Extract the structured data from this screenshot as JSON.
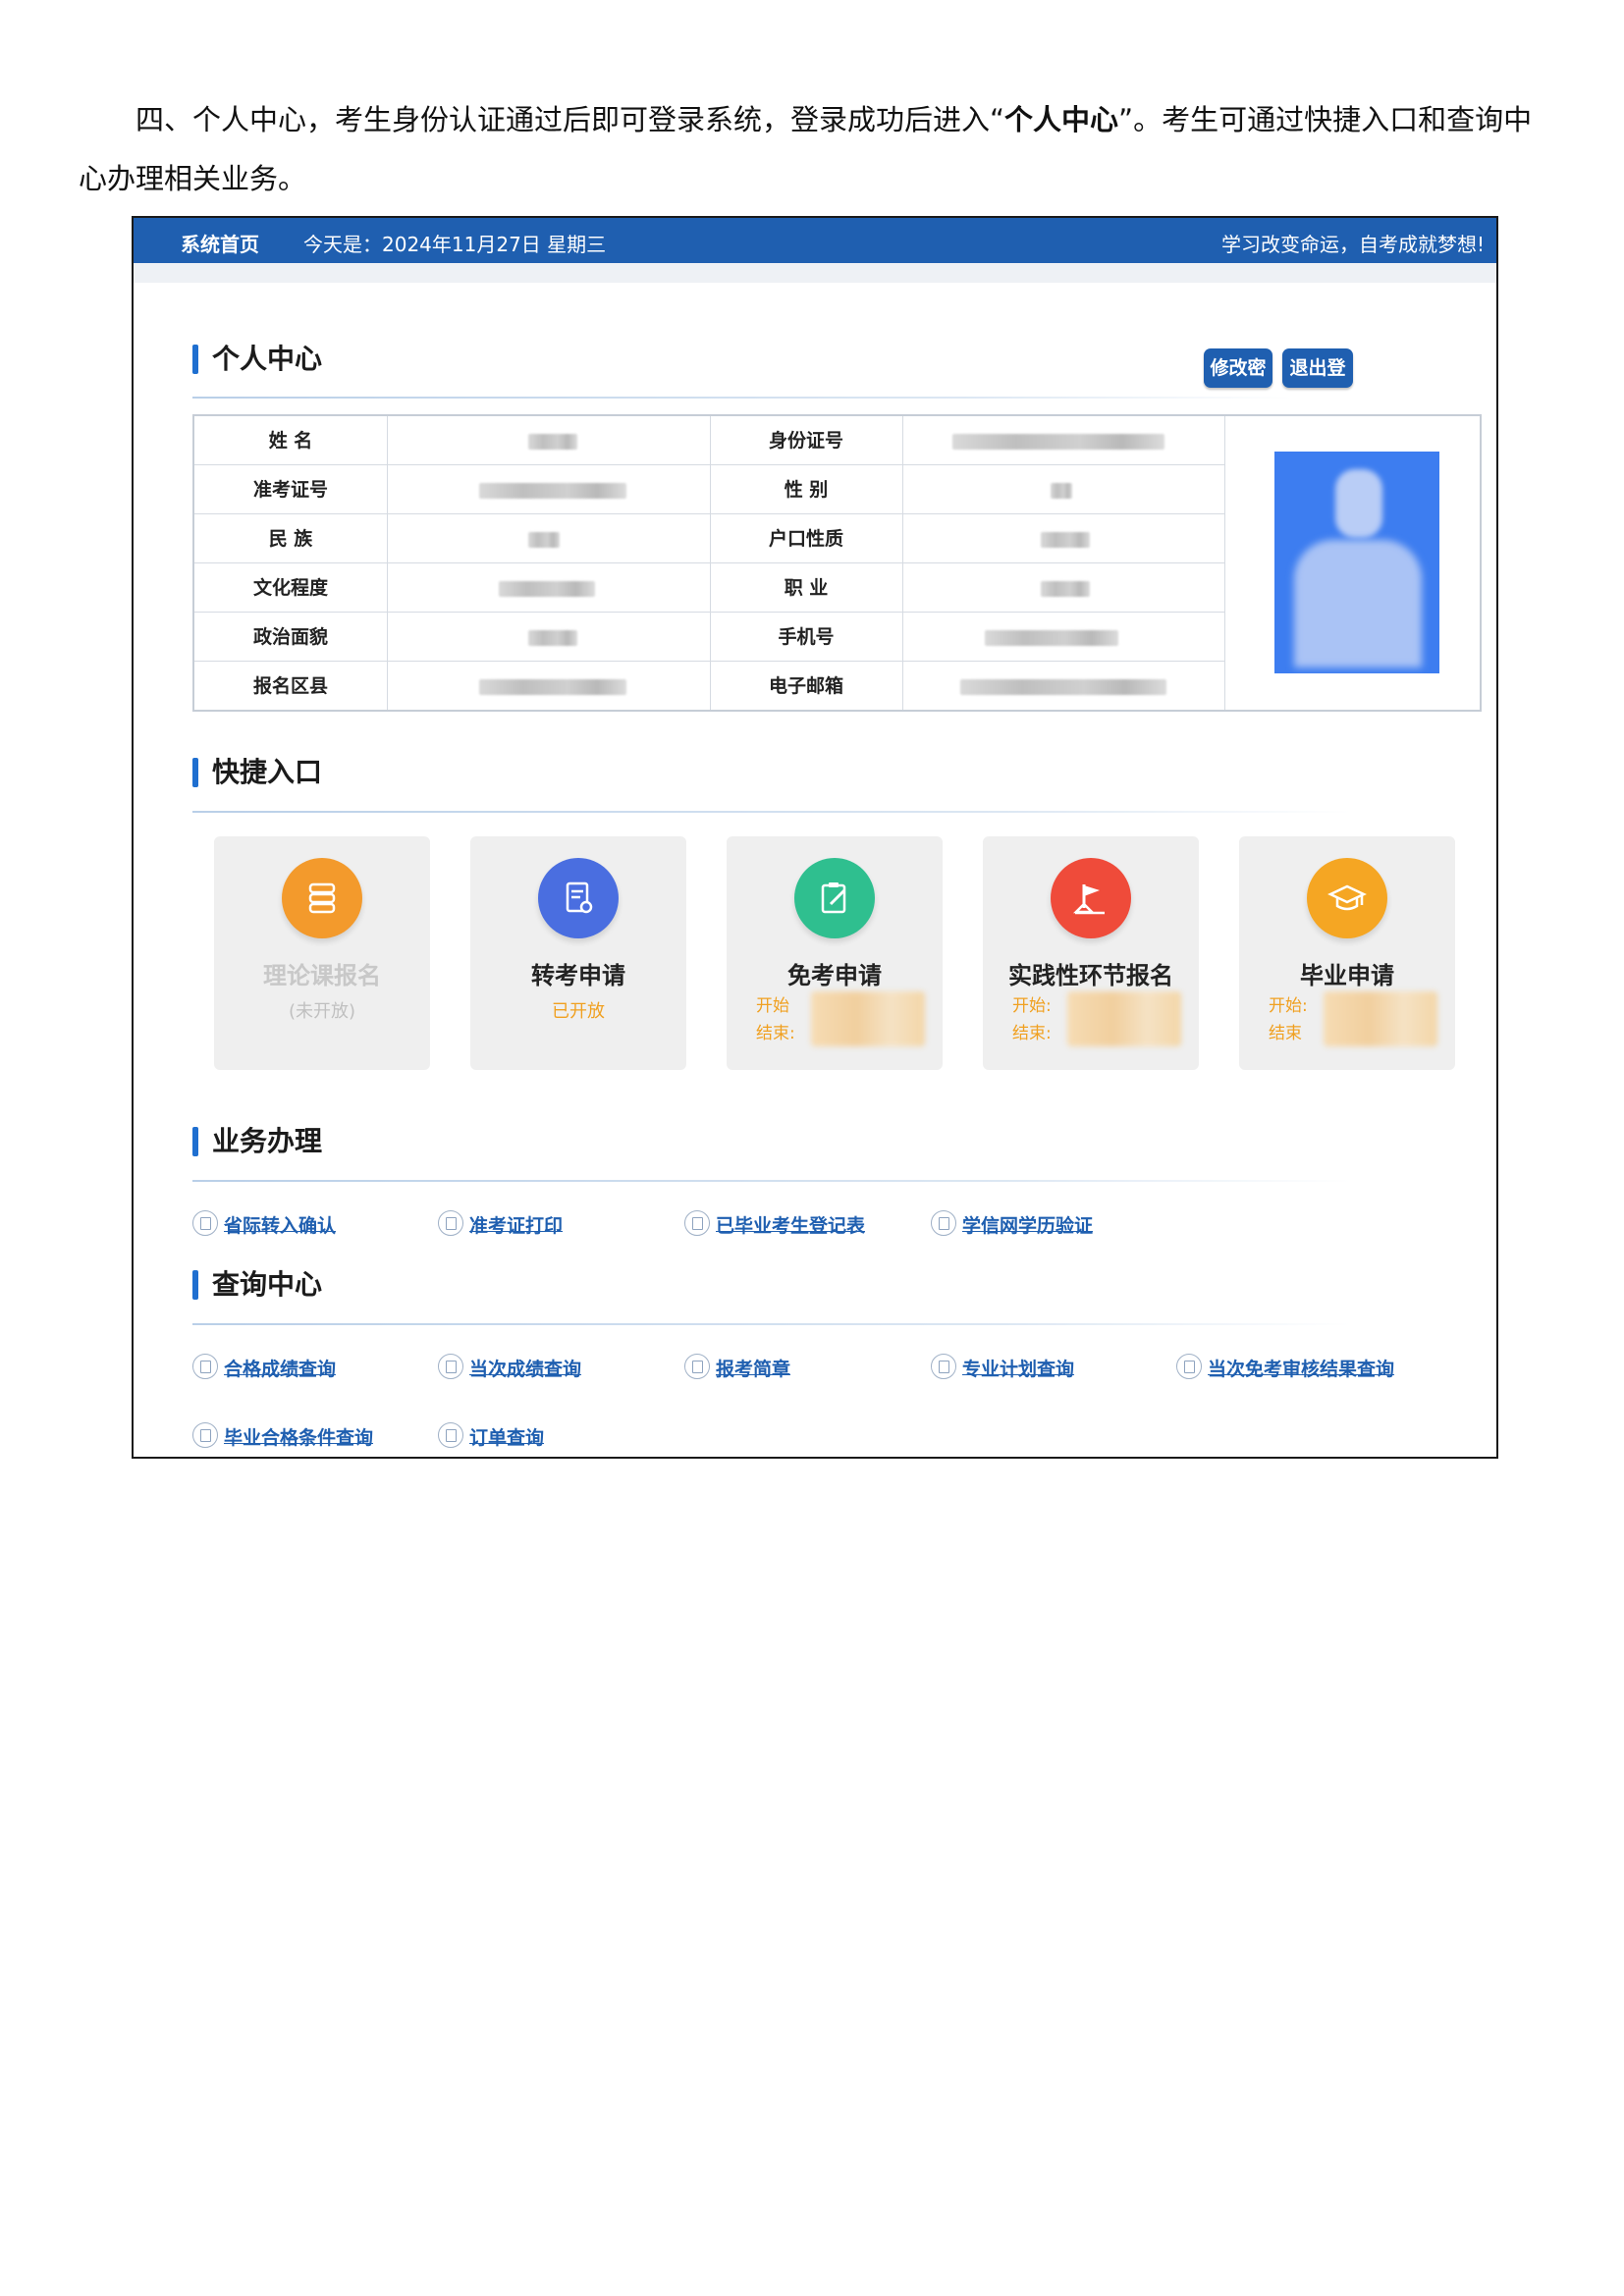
{
  "intro": {
    "part1": "四、个人中心，考生身份认证通过后即可登录系统，登录成功后进入“",
    "bold": "个人中心",
    "part2": "”。考生可通过快捷入口和查询中心办理相关业务。"
  },
  "topbar": {
    "home": "系统首页",
    "date": "今天是：2024年11月27日  星期三",
    "slogan": "学习改变命运，自考成就梦想!"
  },
  "personal": {
    "title": "个人中心",
    "change_password": "修改密码",
    "logout": "退出登录",
    "rows": [
      {
        "label1": "姓  名",
        "label2": "身份证号"
      },
      {
        "label1": "准考证号",
        "label2": "性  别"
      },
      {
        "label1": "民  族",
        "label2": "户口性质"
      },
      {
        "label1": "文化程度",
        "label2": "职  业"
      },
      {
        "label1": "政治面貌",
        "label2": "手机号"
      },
      {
        "label1": "报名区县",
        "label2": "电子邮箱"
      }
    ]
  },
  "quick": {
    "title": "快捷入口",
    "tiles": [
      {
        "name": "理论课报名",
        "status": "(未开放)",
        "color": "#f39a2c"
      },
      {
        "name": "转考申请",
        "status": "已开放",
        "color": "#4a6ee0"
      },
      {
        "name": "免考申请",
        "start": "开始",
        "end": "结束:",
        "color": "#2fbf8f"
      },
      {
        "name": "实践性环节报名",
        "start": "开始:",
        "end": "结束:",
        "color": "#ef4b3a"
      },
      {
        "name": "毕业申请",
        "start": "开始:",
        "end": "结束",
        "color": "#f5a623"
      }
    ]
  },
  "business": {
    "title": "业务办理",
    "links": [
      "省际转入确认",
      "准考证打印",
      "已毕业考生登记表",
      "学信网学历验证"
    ]
  },
  "query": {
    "title": "查询中心",
    "links": [
      "合格成绩查询",
      "当次成绩查询",
      "报考简章",
      "专业计划查询",
      "当次免考审核结果查询",
      "毕业合格条件查询",
      "订单查询"
    ]
  }
}
